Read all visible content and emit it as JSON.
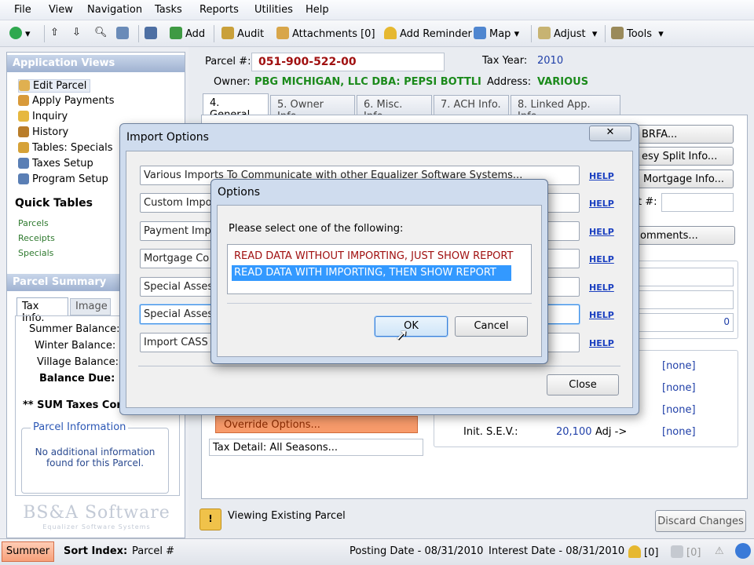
{
  "menu": [
    "File",
    "View",
    "Navigation",
    "Tasks",
    "Reports",
    "Utilities",
    "Help"
  ],
  "toolbar": {
    "add": "Add",
    "audit": "Audit",
    "attachments": "Attachments [0]",
    "add_reminder": "Add Reminder",
    "map": "Map",
    "adjust": "Adjust",
    "tools": "Tools"
  },
  "app_views": {
    "title": "Application Views",
    "items": [
      "Edit Parcel",
      "Apply Payments",
      "Inquiry",
      "History",
      "Tables: Specials",
      "Taxes Setup",
      "Program Setup"
    ]
  },
  "quick_tables": {
    "title": "Quick Tables",
    "items": [
      "Parcels",
      "Receipts",
      "Specials"
    ]
  },
  "parcel_summary": {
    "title": "Parcel Summary",
    "tabs": [
      "Tax Info.",
      "Image"
    ],
    "rows": [
      "Summer Balance:",
      "Winter Balance:",
      "Village Balance:",
      "Balance Due:"
    ],
    "sum_taxes": "** SUM Taxes Cor",
    "info_title": "Parcel Information",
    "info_text": "No additional information found for this Parcel."
  },
  "logo": {
    "text": "BS&A Software",
    "sub": "Equalizer Software Systems"
  },
  "parcel": {
    "label": "Parcel #:",
    "number": "051-900-522-00",
    "tax_year_label": "Tax Year:",
    "tax_year": "2010",
    "owner_label": "Owner:",
    "owner": "PBG MICHIGAN, LLC DBA: PEPSI BOTTLI",
    "address_label": "Address:",
    "address": "VARIOUS"
  },
  "tabs": [
    "4. General",
    "5. Owner Info.",
    "6. Misc. Info",
    "7. ACH Info.",
    "8. Linked App. Info."
  ],
  "right_buttons": [
    "BRFA...",
    "esy Split Info...",
    "Mortgage Info...",
    "omments..."
  ],
  "right_field_label": "t #:",
  "right_value": "0",
  "none_values": [
    "[none]",
    "[none]",
    "[none]",
    "[none]"
  ],
  "sev": {
    "label": "Init. S.E.V.:",
    "value": "20,100",
    "adj": "Adj ->"
  },
  "override": "Override Options...",
  "tax_detail": "Tax Detail: All Seasons...",
  "viewing": "Viewing Existing Parcel",
  "discard": "Discard Changes",
  "import_dialog": {
    "title": "Import Options",
    "items": [
      "Various Imports To Communicate with other Equalizer Software Systems...",
      "Custom Impo",
      "Payment Impo",
      "Mortgage Co",
      "Special Asses",
      "Special Asses",
      "Import CASS"
    ],
    "help": "HELP",
    "close": "Close"
  },
  "options_dialog": {
    "title": "Options",
    "prompt": "Please select one of the following:",
    "choices": [
      "READ DATA WITHOUT IMPORTING, JUST SHOW REPORT",
      "READ DATA WITH IMPORTING, THEN SHOW REPORT"
    ],
    "ok": "OK",
    "cancel": "Cancel"
  },
  "status": {
    "season": "Summer",
    "sort_label": "Sort Index:",
    "sort_value": "Parcel #",
    "posting": "Posting Date - 08/31/2010",
    "interest": "Interest Date - 08/31/2010",
    "count1": "[0]",
    "count2": "[0]"
  },
  "colors": {
    "accent": "#2f6fe0",
    "selection": "#3399ff",
    "parcel_red": "#a01010",
    "owner_green": "#1b8a1b"
  }
}
